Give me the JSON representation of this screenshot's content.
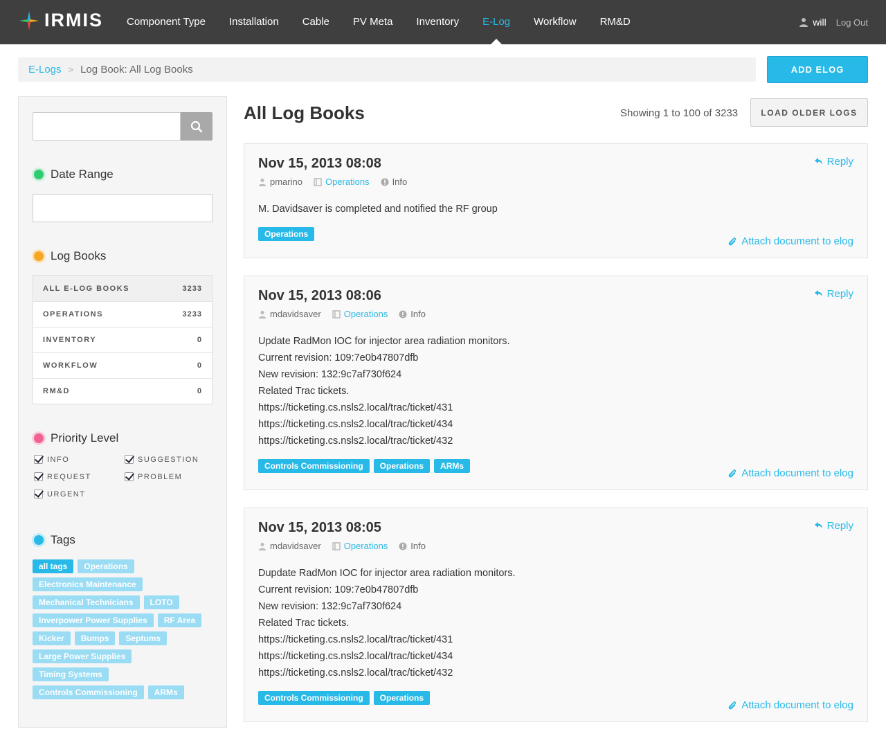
{
  "app": {
    "name": "IRMIS"
  },
  "nav": {
    "items": [
      {
        "label": "Component Type"
      },
      {
        "label": "Installation"
      },
      {
        "label": "Cable"
      },
      {
        "label": "PV Meta"
      },
      {
        "label": "Inventory"
      },
      {
        "label": "E-Log",
        "active": true
      },
      {
        "label": "Workflow"
      },
      {
        "label": "RM&D"
      }
    ],
    "user": "will",
    "logout": "Log Out"
  },
  "breadcrumb": {
    "root": "E-Logs",
    "separator": ">",
    "current": "Log Book: All Log Books"
  },
  "actions": {
    "add_elog": "ADD ELOG",
    "load_older": "LOAD OLDER LOGS"
  },
  "sidebar": {
    "search_placeholder": "",
    "date_range": {
      "title": "Date Range",
      "value": "",
      "dot_color": "#2ecc71"
    },
    "log_books": {
      "title": "Log Books",
      "dot_color": "#f5a623",
      "items": [
        {
          "label": "ALL E-LOG BOOKS",
          "count": "3233"
        },
        {
          "label": "OPERATIONS",
          "count": "3233"
        },
        {
          "label": "INVENTORY",
          "count": "0"
        },
        {
          "label": "WORKFLOW",
          "count": "0"
        },
        {
          "label": "RM&D",
          "count": "0"
        }
      ]
    },
    "priority": {
      "title": "Priority Level",
      "dot_color": "#f06292",
      "items": [
        {
          "label": "INFO",
          "checked": true
        },
        {
          "label": "SUGGESTION",
          "checked": true
        },
        {
          "label": "REQUEST",
          "checked": true
        },
        {
          "label": "PROBLEM",
          "checked": true
        },
        {
          "label": "URGENT",
          "checked": true
        }
      ]
    },
    "tags": {
      "title": "Tags",
      "dot_color": "#27b9e8",
      "items": [
        "all tags",
        "Operations",
        "Electronics Maintenance",
        "Mechanical Technicians",
        "LOTO",
        "Inverpower Power Supplies",
        "RF Area",
        "Kicker",
        "Bumps",
        "Septums",
        "Large Power Supplies",
        "Timing Systems",
        "Controls Commissioning",
        "ARMs"
      ]
    }
  },
  "main": {
    "title": "All Log Books",
    "showing": "Showing 1 to 100 of 3233",
    "reply_label": "Reply",
    "attach_label": "Attach document to elog",
    "entries": [
      {
        "date": "Nov 15, 2013 08:08",
        "author": "pmarino",
        "logbook": "Operations",
        "priority": "Info",
        "lines": [
          "M. Davidsaver is completed and notified the RF group"
        ],
        "tags": [
          "Operations"
        ]
      },
      {
        "date": "Nov 15, 2013 08:06",
        "author": "mdavidsaver",
        "logbook": "Operations",
        "priority": "Info",
        "lines": [
          "Update RadMon IOC for injector area radiation monitors.",
          "Current revision: 109:7e0b47807dfb",
          "New revision: 132:9c7af730f624",
          "Related Trac tickets.",
          "https://ticketing.cs.nsls2.local/trac/ticket/431",
          "https://ticketing.cs.nsls2.local/trac/ticket/434",
          "https://ticketing.cs.nsls2.local/trac/ticket/432"
        ],
        "tags": [
          "Controls Commissioning",
          "Operations",
          "ARMs"
        ]
      },
      {
        "date": "Nov 15, 2013 08:05",
        "author": "mdavidsaver",
        "logbook": "Operations",
        "priority": "Info",
        "lines": [
          "Dupdate RadMon IOC for injector area radiation monitors.",
          "Current revision: 109:7e0b47807dfb",
          "New revision: 132:9c7af730f624",
          "Related Trac tickets.",
          "https://ticketing.cs.nsls2.local/trac/ticket/431",
          "https://ticketing.cs.nsls2.local/trac/ticket/434",
          "https://ticketing.cs.nsls2.local/trac/ticket/432"
        ],
        "tags": [
          "Controls Commissioning",
          "Operations"
        ]
      }
    ]
  }
}
